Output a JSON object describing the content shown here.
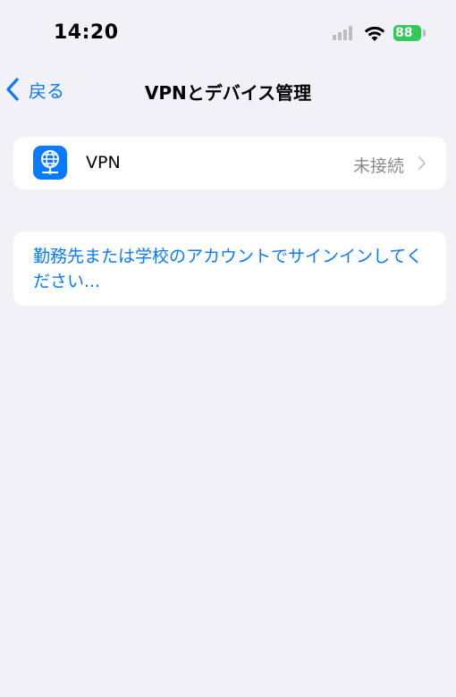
{
  "status_bar": {
    "time": "14:20",
    "battery_level": "88"
  },
  "nav": {
    "back_label": "戻る",
    "title": "VPNとデバイス管理"
  },
  "vpn_row": {
    "label": "VPN",
    "status": "未接続"
  },
  "signin": {
    "text": "勤務先または学校のアカウントでサインインしてください..."
  },
  "colors": {
    "accent": "#0a7aff",
    "battery": "#34c759",
    "background": "#f2f1f7",
    "secondary_text": "#8a8a8e"
  }
}
